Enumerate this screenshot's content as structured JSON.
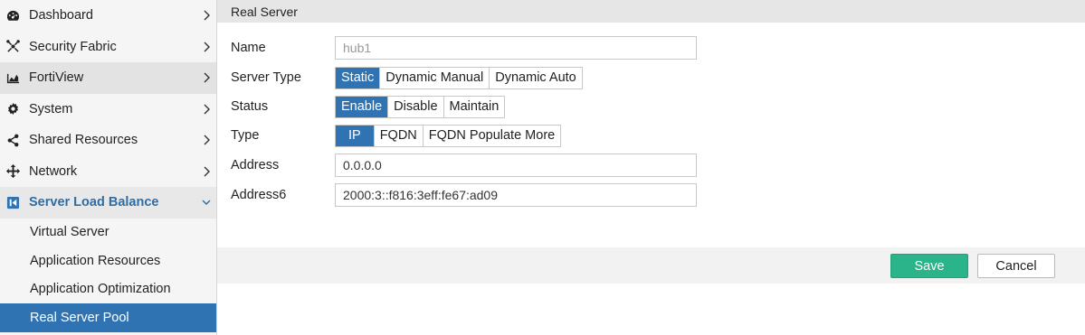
{
  "sidebar": {
    "items": [
      {
        "label": "Dashboard",
        "icon": "dashboard-icon"
      },
      {
        "label": "Security Fabric",
        "icon": "fabric-icon"
      },
      {
        "label": "FortiView",
        "icon": "chart-icon"
      },
      {
        "label": "System",
        "icon": "gear-icon"
      },
      {
        "label": "Shared Resources",
        "icon": "share-icon"
      },
      {
        "label": "Network",
        "icon": "move-arrows-icon"
      },
      {
        "label": "Server Load Balance",
        "icon": "load-balance-icon"
      }
    ],
    "subitems": [
      {
        "label": "Virtual Server"
      },
      {
        "label": "Application Resources"
      },
      {
        "label": "Application Optimization"
      },
      {
        "label": "Real Server Pool"
      }
    ]
  },
  "panel": {
    "title": "Real Server",
    "name_label": "Name",
    "name_value": "hub1",
    "server_type_label": "Server Type",
    "server_type_options": [
      "Static",
      "Dynamic Manual",
      "Dynamic Auto"
    ],
    "server_type_selected": "Static",
    "status_label": "Status",
    "status_options": [
      "Enable",
      "Disable",
      "Maintain"
    ],
    "status_selected": "Enable",
    "type_label": "Type",
    "type_options": [
      "IP",
      "FQDN",
      "FQDN Populate More"
    ],
    "type_selected": "IP",
    "address_label": "Address",
    "address_value": "0.0.0.0",
    "address6_label": "Address6",
    "address6_value": "2000:3::f816:3eff:fe67:ad09"
  },
  "footer": {
    "save_label": "Save",
    "cancel_label": "Cancel"
  },
  "colors": {
    "accent": "#2f73b3",
    "save": "#2bb48a"
  }
}
